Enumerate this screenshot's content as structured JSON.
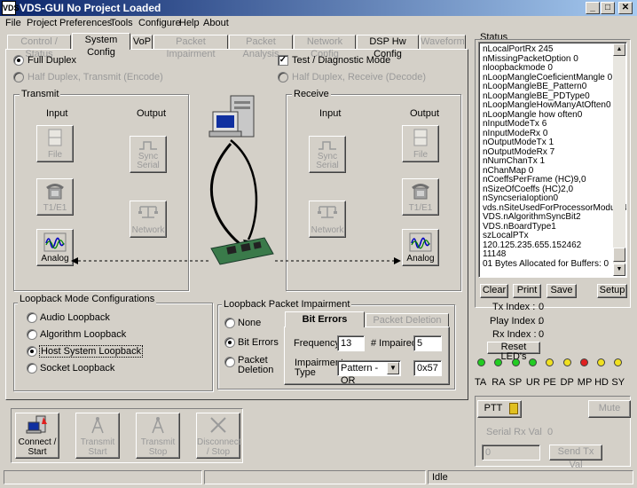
{
  "window": {
    "title": "VDS-GUI No Project Loaded",
    "app_icon": "VDS"
  },
  "menu": [
    "File",
    "Project",
    "Preferences",
    "Tools",
    "Configure",
    "Help",
    "About"
  ],
  "tabs": [
    {
      "label": "Control / Status",
      "enabled": false
    },
    {
      "label": "System Config",
      "enabled": true,
      "active": true
    },
    {
      "label": "VoP",
      "enabled": true
    },
    {
      "label": "Packet Impairment",
      "enabled": false
    },
    {
      "label": "Packet Analysis",
      "enabled": false
    },
    {
      "label": "Network Config",
      "enabled": false
    },
    {
      "label": "DSP Hw Config",
      "enabled": true
    },
    {
      "label": "Waveform",
      "enabled": false
    }
  ],
  "duplex": {
    "full": "Full Duplex",
    "half_transmit": "Half Duplex, Transmit (Encode)",
    "test_mode": "Test / Diagnostic Mode",
    "half_receive": "Half Duplex, Receive (Decode)"
  },
  "transmit": {
    "title": "Transmit",
    "input": "Input",
    "output": "Output",
    "file": "File",
    "t1e1": "T1/E1",
    "analog": "Analog",
    "sync_serial": "Sync Serial",
    "network": "Network"
  },
  "receive": {
    "title": "Receive",
    "input": "Input",
    "output": "Output",
    "sync_serial": "Sync Serial",
    "network": "Network",
    "file": "File",
    "t1e1": "T1/E1",
    "analog": "Analog"
  },
  "loopback": {
    "title": "Loopback Mode Configurations",
    "options": [
      "Audio Loopback",
      "Algorithm Loopback",
      "Host System Loopback",
      "Socket Loopback"
    ],
    "selected": "Host System Loopback"
  },
  "impairment": {
    "title": "Loopback Packet Impairment",
    "options": [
      "None",
      "Bit Errors",
      "Packet Deletion"
    ],
    "selected": "Bit Errors",
    "tab_bit_errors": "Bit Errors",
    "tab_packet_deletion": "Packet Deletion",
    "frequency_label": "Frequency",
    "frequency": "13",
    "impaired_label": "# Impaired",
    "impaired": "5",
    "impairment_type_label": "Impairment Type",
    "impairment_type": "Pattern - OR",
    "pattern": "0x57"
  },
  "bottom_buttons": {
    "connect": "Connect / Start",
    "transmit_start": "Transmit Start",
    "transmit_stop": "Transmit Stop",
    "disconnect": "Disconnect / Stop"
  },
  "statusbar": {
    "state": "Idle"
  },
  "status": {
    "title": "Status",
    "lines": [
      "nLocalPortRx 245",
      "nMissingPacketOption 0",
      "nloopbackmode 0",
      "nLoopMangleCoeficientMangle 0",
      "nLoopMangleBE_Pattern0",
      "nLoopMangleBE_PDType0",
      "nLoopMangleHowManyAtOften0",
      "nLoopMangle how often0",
      "nInputModeTx 6",
      "nInputModeRx 0",
      "nOutputModeTx 1",
      "nOutputModeRx 7",
      "nNumChanTx 1",
      "nChanMap 0",
      "nCoeffsPerFrame (HC)9,0",
      "nSizeOfCoeffs (HC)2,0",
      "nSyncseriaIoption0",
      "vds.nSiteUsedForProcessorModule4",
      "VDS.nAlgorithmSyncBit2",
      "VDS.nBoardType1",
      "szLocalPTx",
      "120.125.235.655.152462",
      "11148",
      "01 Bytes Allocated for Buffers: 0"
    ],
    "clear": "Clear",
    "print": "Print",
    "save": "Save",
    "setup": "Setup",
    "tx_index_label": "Tx Index :",
    "tx_index": "0",
    "play_index_label": "Play Index :",
    "play_index": "0",
    "rx_index_label": "Rx Index :",
    "rx_index": "0",
    "reset_leds": "Reset LED's",
    "leds": [
      {
        "label": "TA",
        "color": "#22cc22"
      },
      {
        "label": "RA",
        "color": "#22cc22"
      },
      {
        "label": "SP",
        "color": "#22cc22"
      },
      {
        "label": "UR",
        "color": "#22cc22"
      },
      {
        "label": "PE",
        "color": "#f0e020"
      },
      {
        "label": "DP",
        "color": "#f0e020"
      },
      {
        "label": "MP",
        "color": "#e02020"
      },
      {
        "label": "HD",
        "color": "#f0e020"
      },
      {
        "label": "SY",
        "color": "#f0e020"
      }
    ],
    "ptt": "PTT",
    "mute": "Mute",
    "serial_rx_label": "Serial Rx Val",
    "serial_rx": "0",
    "send_input": "0",
    "send_tx": "Send Tx Val"
  }
}
